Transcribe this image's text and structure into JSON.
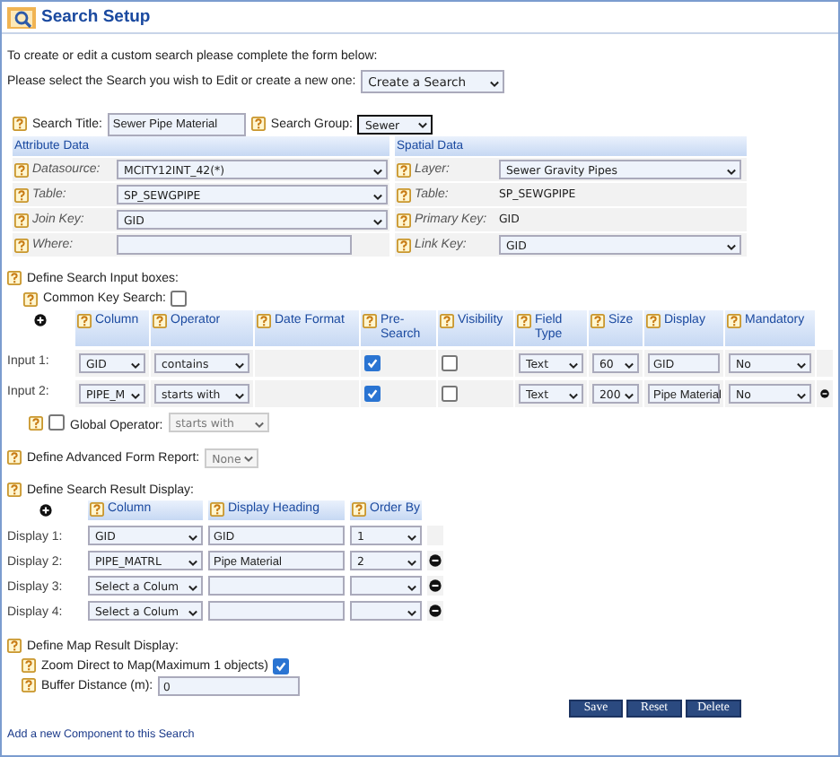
{
  "title": "Search Setup",
  "intro": "To create or edit a custom search please complete the form below:",
  "select_prompt": "Please select the Search you wish to Edit or create a new one:",
  "search_select": "Create a Search",
  "search_title": {
    "label": "Search Title:",
    "value": "Sewer Pipe Material"
  },
  "search_group": {
    "label": "Search Group:",
    "value": "Sewer"
  },
  "attribute_data": {
    "heading": "Attribute Data",
    "rows": [
      {
        "label": "Datasource:",
        "kind": "select",
        "value": "MCITY12INT_42(*)"
      },
      {
        "label": "Table:",
        "kind": "select",
        "value": "SP_SEWGPIPE"
      },
      {
        "label": "Join Key:",
        "kind": "select",
        "value": "GID"
      },
      {
        "label": "Where:",
        "kind": "input"
      }
    ]
  },
  "spatial_data": {
    "heading": "Spatial Data",
    "rows": [
      {
        "label": "Layer:",
        "kind": "select",
        "value": "Sewer Gravity Pipes"
      },
      {
        "label": "Table:",
        "kind": "text",
        "value": "SP_SEWGPIPE"
      },
      {
        "label": "Primary Key:",
        "kind": "text",
        "value": "GID"
      },
      {
        "label": "Link Key:",
        "kind": "select",
        "value": "GID"
      }
    ]
  },
  "input_boxes": {
    "heading": "Define Search Input boxes:",
    "common_key": {
      "label": "Common Key Search:",
      "checked": false
    },
    "columns": [
      "Column",
      "Operator",
      "Date Format",
      "Pre-Search",
      "Visibility",
      "Field Type",
      "Size",
      "Display",
      "Mandatory"
    ],
    "rows": [
      {
        "label": "Input 1:",
        "column": "GID",
        "operator": "contains",
        "pre_search": true,
        "visibility": false,
        "field_type": "Text",
        "size": "60",
        "display": "GID",
        "mandatory": "No",
        "removable": false
      },
      {
        "label": "Input 2:",
        "column": "PIPE_M",
        "operator": "starts with",
        "pre_search": true,
        "visibility": false,
        "field_type": "Text",
        "size": "200",
        "display": "Pipe Material",
        "mandatory": "No",
        "removable": true
      }
    ],
    "global_operator": {
      "label": "Global Operator:",
      "checked": false,
      "value": "starts with"
    }
  },
  "advanced_report": {
    "label": "Define Advanced Form Report:",
    "value": "None"
  },
  "result_display": {
    "heading": "Define Search Result Display:",
    "columns": [
      "Column",
      "Display Heading",
      "Order By"
    ],
    "rows": [
      {
        "label": "Display 1:",
        "column": "GID",
        "heading": "GID",
        "order": "1",
        "removable": false
      },
      {
        "label": "Display 2:",
        "column": "PIPE_MATRL",
        "heading": "Pipe Material",
        "order": "2",
        "removable": true
      },
      {
        "label": "Display 3:",
        "column": "Select a Colum",
        "heading": "",
        "order": "",
        "removable": true
      },
      {
        "label": "Display 4:",
        "column": "Select a Colum",
        "heading": "",
        "order": "",
        "removable": true
      }
    ]
  },
  "map_display": {
    "heading": "Define Map Result Display:",
    "zoom": {
      "label": "Zoom Direct to Map(Maximum 1 objects)",
      "checked": true
    },
    "buffer": {
      "label": "Buffer Distance (m):",
      "value": "0"
    }
  },
  "buttons": [
    "Save",
    "Reset",
    "Delete"
  ],
  "footer_link": "Add a new Component to this Search"
}
